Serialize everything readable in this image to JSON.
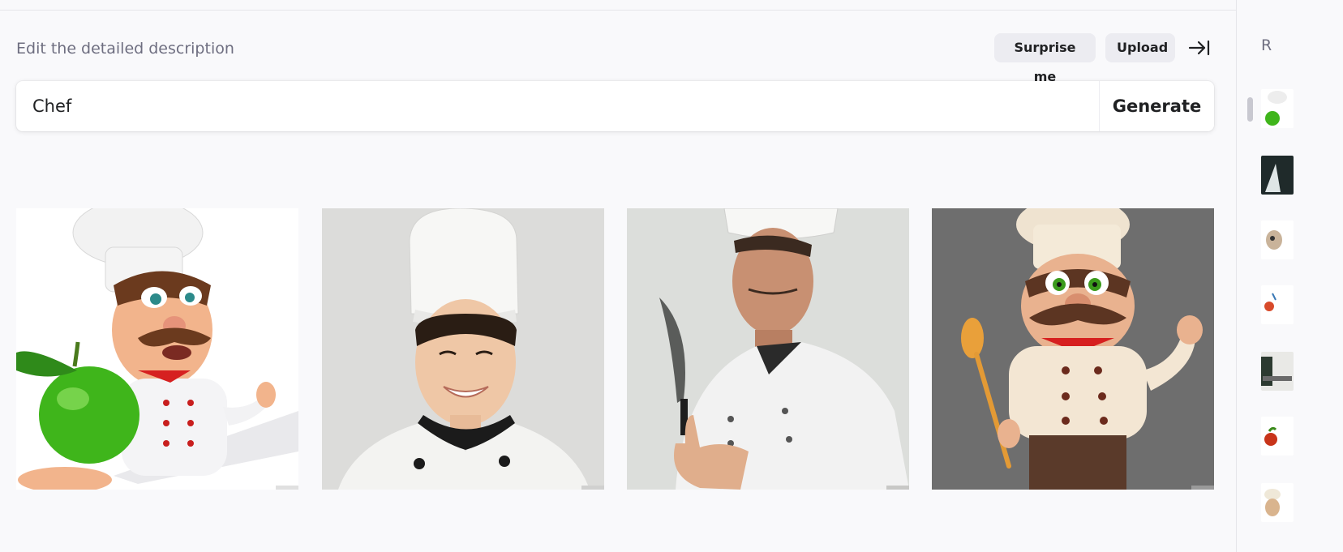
{
  "header": {
    "hint_text": "Edit the detailed description",
    "surprise_label": "Surprise me",
    "upload_label": "Upload",
    "collapse_icon": "collapse-right-icon"
  },
  "prompt": {
    "value": "Chef",
    "generate_label": "Generate"
  },
  "results": [
    {
      "icon": "cartoon-chef-with-apple-image"
    },
    {
      "icon": "female-chef-photo-image"
    },
    {
      "icon": "male-chef-with-knife-image"
    },
    {
      "icon": "cartoon-chef-with-spoon-image"
    }
  ],
  "sidebar": {
    "title": "R",
    "history": [
      {
        "icon": "history-thumb-icon"
      },
      {
        "icon": "history-thumb-icon"
      },
      {
        "icon": "history-thumb-icon"
      },
      {
        "icon": "history-thumb-icon"
      },
      {
        "icon": "history-thumb-icon"
      },
      {
        "icon": "history-thumb-icon"
      },
      {
        "icon": "history-thumb-icon"
      }
    ]
  },
  "colors": {
    "background": "#f9f9fb",
    "pill": "#ececf1",
    "text": "#202123",
    "muted": "#6e6e80"
  }
}
